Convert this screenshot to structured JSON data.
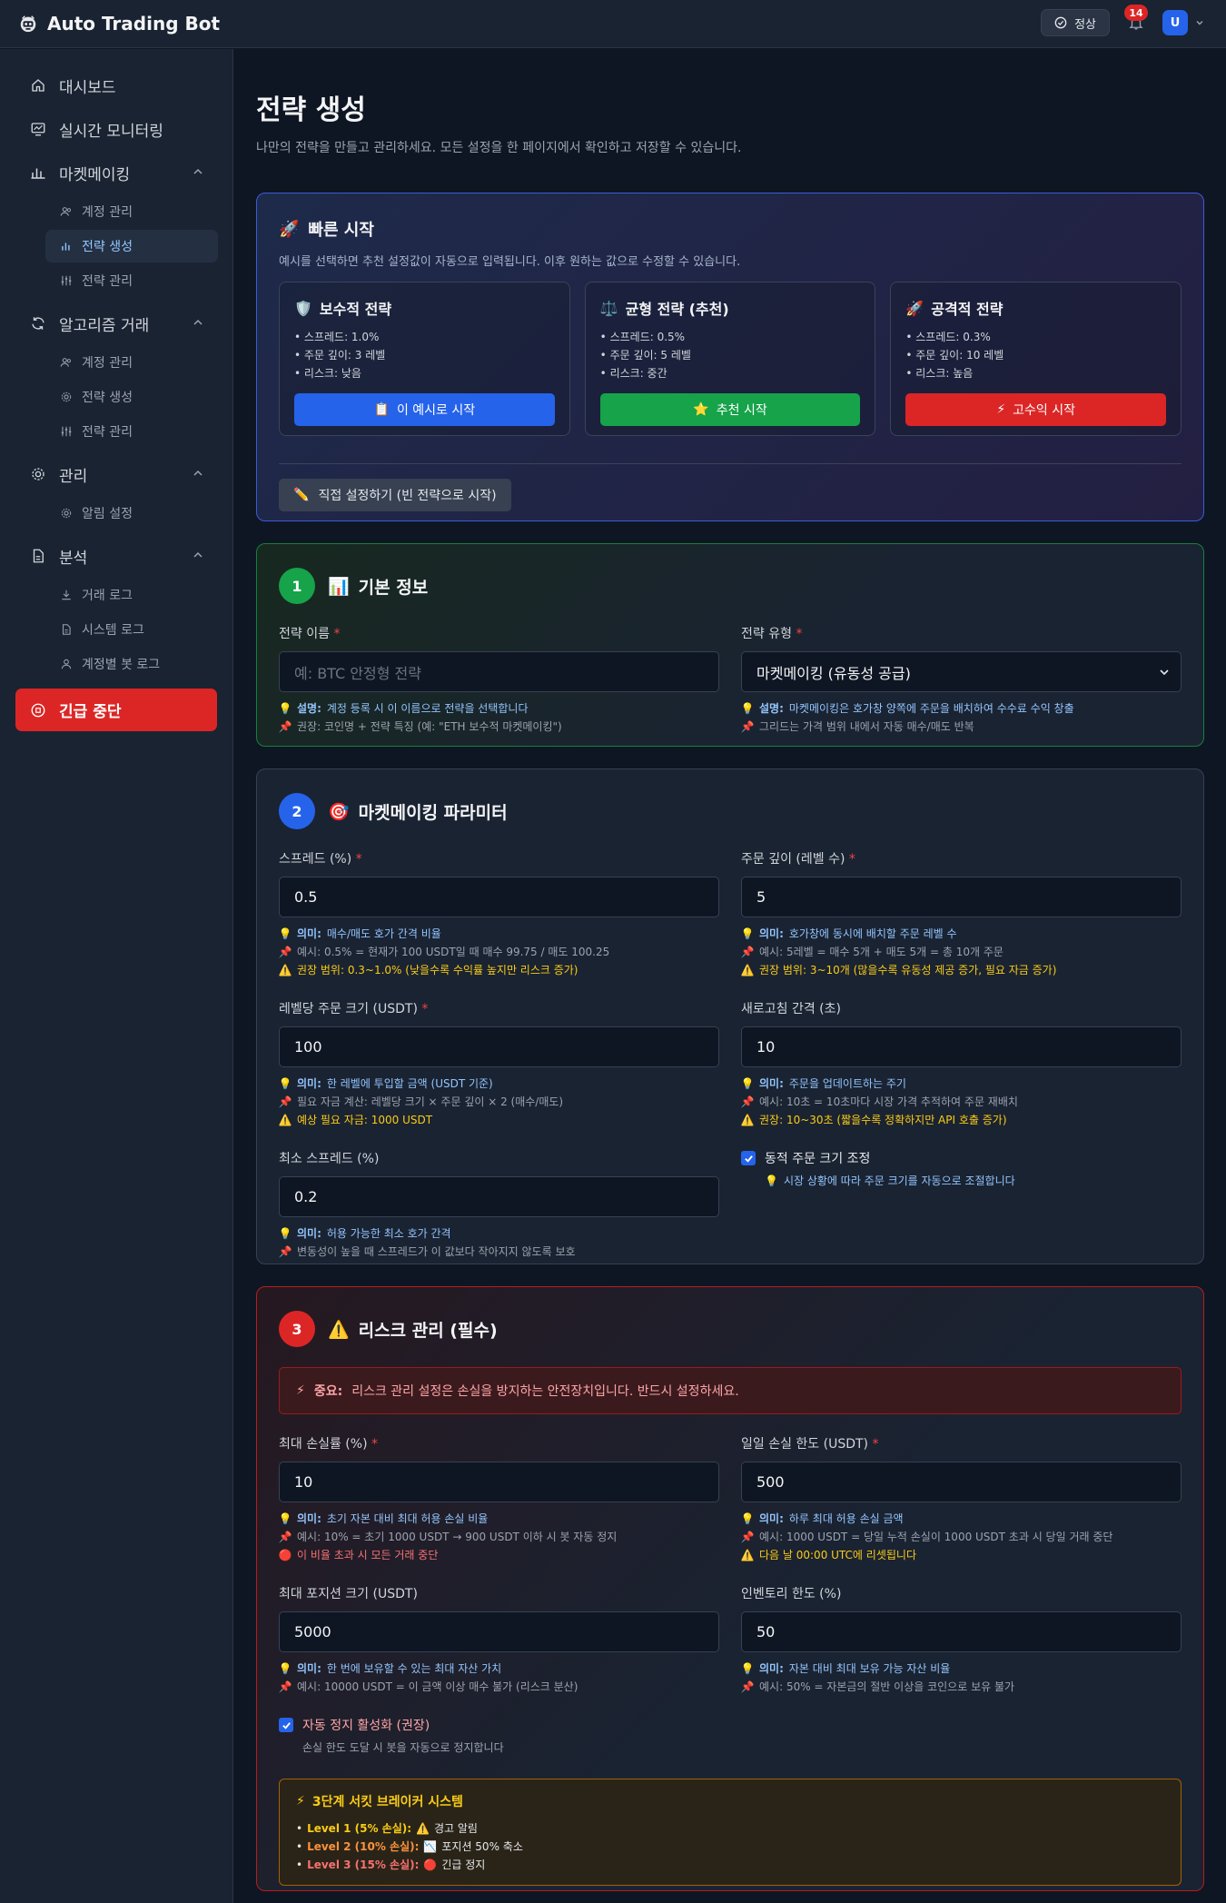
{
  "header": {
    "title": "Auto Trading Bot",
    "status": "정상",
    "notifications": "14",
    "avatar": "U"
  },
  "sidebar": {
    "dashboard": "대시보드",
    "monitoring": "실시간 모니터링",
    "mm_group": "마켓메이킹",
    "mm_items": [
      "계정 관리",
      "전략 생성",
      "전략 관리"
    ],
    "algo_group": "알고리즘 거래",
    "algo_items": [
      "계정 관리",
      "전략 생성",
      "전략 관리"
    ],
    "admin_group": "관리",
    "admin_items": [
      "알림 설정"
    ],
    "analysis_group": "분석",
    "analysis_items": [
      "거래 로그",
      "시스템 로그",
      "계정별 봇 로그"
    ],
    "emergency": "긴급 중단"
  },
  "page": {
    "title": "전략 생성",
    "subtitle": "나만의 전략을 만들고 관리하세요. 모든 설정을 한 페이지에서 확인하고 저장할 수 있습니다."
  },
  "quick": {
    "title": "빠른 시작",
    "desc": "예시를 선택하면 추천 설정값이 자동으로 입력됩니다. 이후 원하는 값으로 수정할 수 있습니다.",
    "presets": [
      {
        "title": "보수적 전략",
        "spread": "스프레드: 1.0%",
        "depth": "주문 깊이: 3 레벨",
        "risk": "리스크: 낮음",
        "button": "이 예시로 시작",
        "color": "#2563eb"
      },
      {
        "title": "균형 전략 (추천)",
        "spread": "스프레드: 0.5%",
        "depth": "주문 깊이: 5 레벨",
        "risk": "리스크: 중간",
        "button": "추천 시작",
        "color": "#16a34a"
      },
      {
        "title": "공격적 전략",
        "spread": "스프레드: 0.3%",
        "depth": "주문 깊이: 10 레벨",
        "risk": "리스크: 높음",
        "button": "고수익 시작",
        "color": "#dc2626"
      }
    ],
    "custom": "직접 설정하기 (빈 전략으로 시작)"
  },
  "basic": {
    "num": "1",
    "title": "기본 정보",
    "name_label": "전략 이름",
    "name_placeholder": "예: BTC 안정형 전략",
    "name_hint1_b": "설명:",
    "name_hint1": "계정 등록 시 이 이름으로 전략을 선택합니다",
    "name_hint2": "권장: 코인명 + 전략 특징 (예: \"ETH 보수적 마켓메이킹\")",
    "type_label": "전략 유형",
    "type_value": "마켓메이킹 (유동성 공급)",
    "type_hint1_b": "설명:",
    "type_hint1": "마켓메이킹은 호가창 양쪽에 주문을 배치하여 수수료 수익 창출",
    "type_hint2": "그리드는 가격 범위 내에서 자동 매수/매도 반복"
  },
  "mm": {
    "num": "2",
    "title": "마켓메이킹 파라미터",
    "spread_label": "스프레드 (%)",
    "spread_value": "0.5",
    "spread_h1_b": "의미:",
    "spread_h1": "매수/매도 호가 간격 비율",
    "spread_h2": "예시: 0.5% = 현재가 100 USDT일 때 매수 99.75 / 매도 100.25",
    "spread_h3": "권장 범위: 0.3~1.0% (낮을수록 수익률 높지만 리스크 증가)",
    "depth_label": "주문 깊이 (레벨 수)",
    "depth_value": "5",
    "depth_h1_b": "의미:",
    "depth_h1": "호가창에 동시에 배치할 주문 레벨 수",
    "depth_h2": "예시: 5레벨 = 매수 5개 + 매도 5개 = 총 10개 주문",
    "depth_h3": "권장 범위: 3~10개 (많을수록 유동성 제공 증가, 필요 자금 증가)",
    "size_label": "레벨당 주문 크기 (USDT)",
    "size_value": "100",
    "size_h1_b": "의미:",
    "size_h1": "한 레벨에 투입할 금액 (USDT 기준)",
    "size_h2": "필요 자금 계산: 레벨당 크기 × 주문 깊이 × 2 (매수/매도)",
    "size_h3": "예상 필요 자금: 1000 USDT",
    "refresh_label": "새로고침 간격 (초)",
    "refresh_value": "10",
    "refresh_h1_b": "의미:",
    "refresh_h1": "주문을 업데이트하는 주기",
    "refresh_h2": "예시: 10초 = 10초마다 시장 가격 추적하여 주문 재배치",
    "refresh_h3": "권장: 10~30초 (짧을수록 정확하지만 API 호출 증가)",
    "min_label": "최소 스프레드 (%)",
    "min_value": "0.2",
    "min_h1_b": "의미:",
    "min_h1": "허용 가능한 최소 호가 간격",
    "min_h2": "변동성이 높을 때 스프레드가 이 값보다 작아지지 않도록 보호",
    "dynamic_label": "동적 주문 크기 조정",
    "dynamic_hint": "시장 상황에 따라 주문 크기를 자동으로 조절합니다"
  },
  "risk": {
    "num": "3",
    "title": "리스크 관리 (필수)",
    "alert_b": "중요:",
    "alert": "리스크 관리 설정은 손실을 방지하는 안전장치입니다. 반드시 설정하세요.",
    "maxloss_label": "최대 손실률 (%)",
    "maxloss_value": "10",
    "maxloss_h1_b": "의미:",
    "maxloss_h1": "초기 자본 대비 최대 허용 손실 비율",
    "maxloss_h2": "예시: 10% = 초기 1000 USDT → 900 USDT 이하 시 봇 자동 정지",
    "maxloss_h3": "이 비율 초과 시 모든 거래 중단",
    "daily_label": "일일 손실 한도 (USDT)",
    "daily_value": "500",
    "daily_h1_b": "의미:",
    "daily_h1": "하루 최대 허용 손실 금액",
    "daily_h2": "예시: 1000 USDT = 당일 누적 손실이 1000 USDT 초과 시 당일 거래 중단",
    "daily_h3": "다음 날 00:00 UTC에 리셋됩니다",
    "pos_label": "최대 포지션 크기 (USDT)",
    "pos_value": "5000",
    "pos_h1_b": "의미:",
    "pos_h1": "한 번에 보유할 수 있는 최대 자산 가치",
    "pos_h2": "예시: 10000 USDT = 이 금액 이상 매수 불가 (리스크 분산)",
    "inv_label": "인벤토리 한도 (%)",
    "inv_value": "50",
    "inv_h1_b": "의미:",
    "inv_h1": "자본 대비 최대 보유 가능 자산 비율",
    "inv_h2": "예시: 50% = 자본금의 절반 이상을 코인으로 보유 불가",
    "autostop_label": "자동 정지 활성화 (권장)",
    "autostop_hint": "손실 한도 도달 시 봇을 자동으로 정지합니다",
    "breaker_title": "3단계 서킷 브레이커 시스템",
    "breaker": [
      {
        "level": "Level 1 (5% 손실):",
        "action": "경고 알림"
      },
      {
        "level": "Level 2 (10% 손실):",
        "action": "포지션 50% 축소"
      },
      {
        "level": "Level 3 (15% 손실):",
        "action": "긴급 정지"
      }
    ]
  }
}
